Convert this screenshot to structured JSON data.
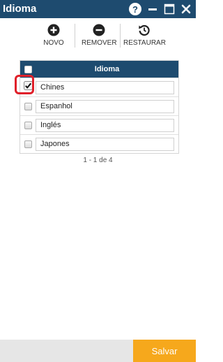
{
  "window": {
    "title": "Idioma",
    "help_label": "?"
  },
  "toolbar": {
    "new_label": "NOVO",
    "remove_label": "REMOVER",
    "restore_label": "RESTAURAR"
  },
  "grid": {
    "header": "Idioma",
    "rows": [
      {
        "value": "Chines",
        "checked": true
      },
      {
        "value": "Espanhol",
        "checked": false
      },
      {
        "value": "Inglés",
        "checked": false
      },
      {
        "value": "Japones",
        "checked": false
      }
    ]
  },
  "pager": {
    "text": "1 - 1 de 4"
  },
  "footer": {
    "save_label": "Salvar"
  },
  "colors": {
    "titlebar": "#1e4b6f",
    "accent": "#f6a81c",
    "highlight": "#e0202a"
  }
}
